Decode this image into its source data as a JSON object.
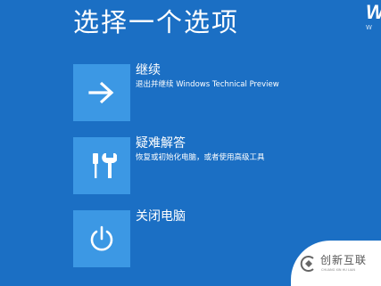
{
  "header": {
    "title": "选择一个选项"
  },
  "brand": {
    "logo_text": "W",
    "logo_subtext": "W"
  },
  "options": [
    {
      "label": "继续",
      "description": "退出并继续 Windows Technical Preview",
      "icon": "arrow-right-icon"
    },
    {
      "label": "疑难解答",
      "description": "恢复或初始化电脑，或者使用高级工具",
      "icon": "tools-icon"
    },
    {
      "label": "关闭电脑",
      "description": "",
      "icon": "power-icon"
    }
  ],
  "watermark": {
    "text": "创新互联",
    "subtext": "CHUANG XIN HU LIAN"
  },
  "colors": {
    "background": "#1b6fc4",
    "tile": "#3c98e4",
    "text": "#ffffff"
  }
}
